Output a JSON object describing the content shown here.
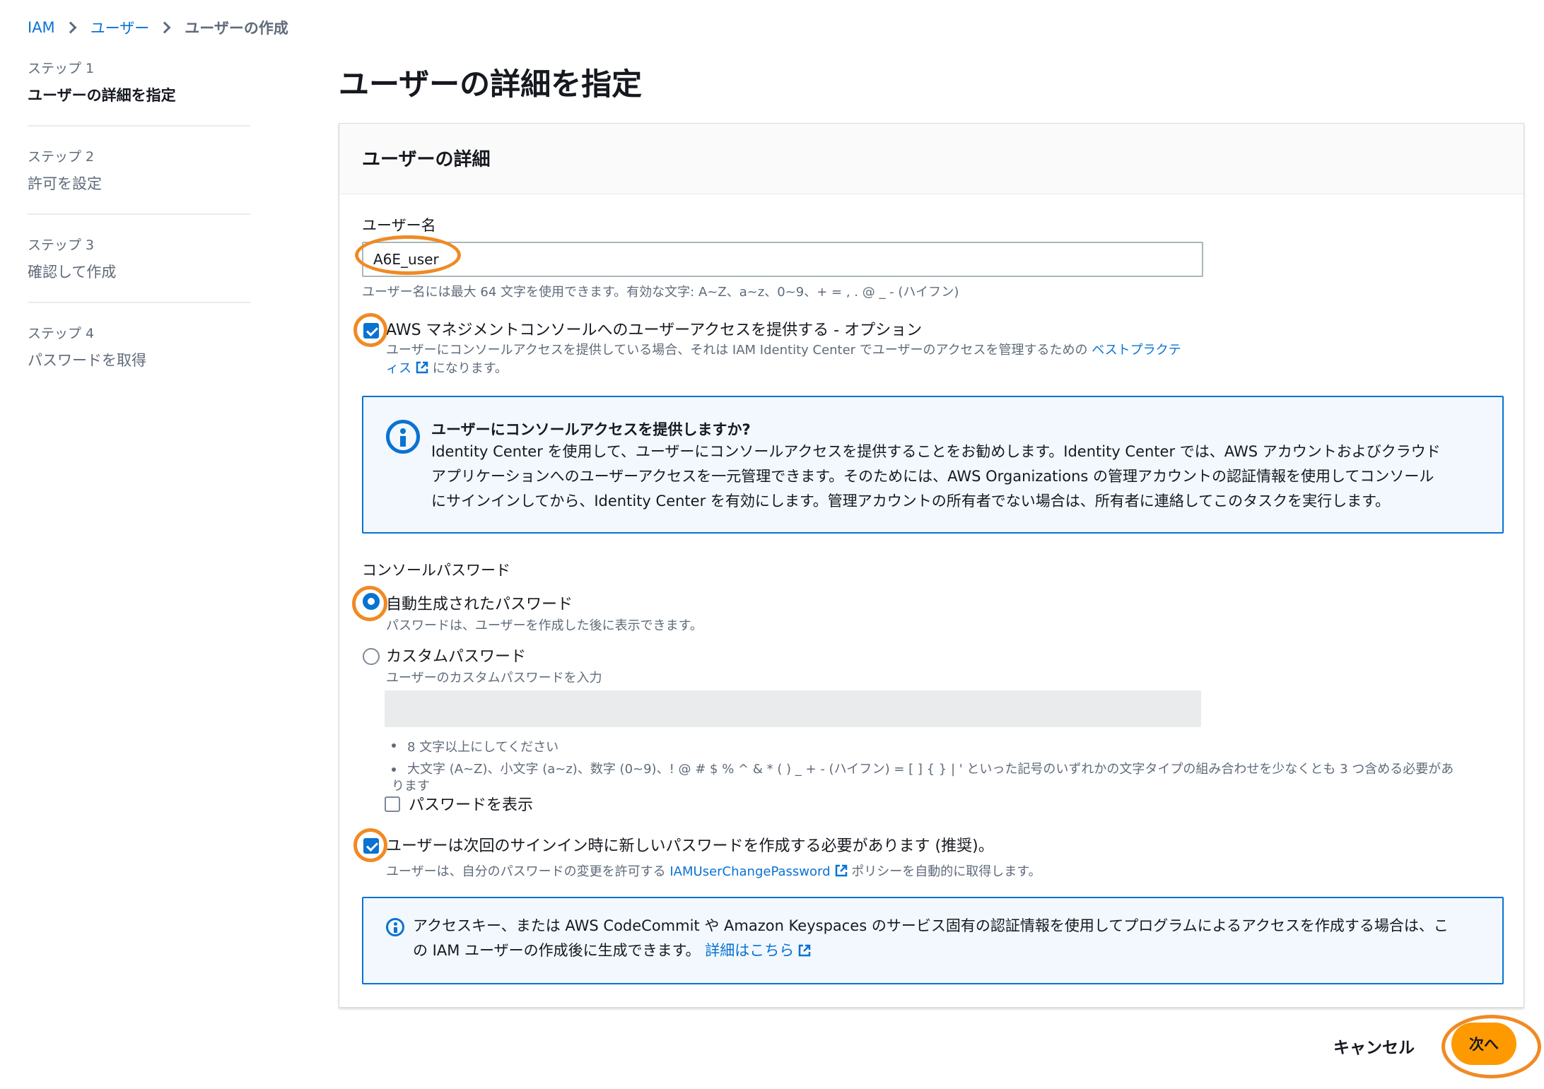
{
  "breadcrumb": {
    "items": [
      "IAM",
      "ユーザー",
      "ユーザーの作成"
    ]
  },
  "steps": [
    {
      "num": "ステップ 1",
      "title": "ユーザーの詳細を指定"
    },
    {
      "num": "ステップ 2",
      "title": "許可を設定"
    },
    {
      "num": "ステップ 3",
      "title": "確認して作成"
    },
    {
      "num": "ステップ 4",
      "title": "パスワードを取得"
    }
  ],
  "page_title": "ユーザーの詳細を指定",
  "panel": {
    "header": "ユーザーの詳細",
    "username_label": "ユーザー名",
    "username_value": "A6E_user",
    "username_hint": "ユーザー名には最大 64 文字を使用できます。有効な文字: A~Z、a~z、0~9、+ = , . @ _ - (ハイフン)",
    "console_access_label": "AWS マネジメントコンソールへのユーザーアクセスを提供する - オプション",
    "console_access_desc1": "ユーザーにコンソールアクセスを提供している場合、それは IAM Identity Center でユーザーのアクセスを管理するための",
    "console_access_link1": "ベストプラクテ",
    "console_access_link2": "ィス",
    "console_access_desc2": "になります。",
    "info1": {
      "title": "ユーザーにコンソールアクセスを提供しますか?",
      "line1": "Identity Center を使用して、ユーザーにコンソールアクセスを提供することをお勧めします。Identity Center では、AWS アカウントおよびクラウド",
      "line2": "アプリケーションへのユーザーアクセスを一元管理できます。そのためには、AWS Organizations の管理アカウントの認証情報を使用してコンソール",
      "line3": "にサインインしてから、Identity Center を有効にします。管理アカウントの所有者でない場合は、所有者に連絡してこのタスクを実行します。"
    },
    "console_password_label": "コンソールパスワード",
    "radio_auto_label": "自動生成されたパスワード",
    "radio_auto_desc": "パスワードは、ユーザーを作成した後に表示できます。",
    "radio_custom_label": "カスタムパスワード",
    "radio_custom_desc": "ユーザーのカスタムパスワードを入力",
    "bullet1": "8 文字以上にしてください",
    "bullet2a": "大文字 (A~Z)、小文字 (a~z)、数字 (0~9)、! @ # $ % ^ & * ( ) _ + - (ハイフン) = [ ] { } | ' といった記号のいずれかの文字タイプの組み合わせを少なくとも 3 つ含める必要があ",
    "bullet2b": "ります",
    "show_password_label": "パスワードを表示",
    "require_reset_label": "ユーザーは次回のサインイン時に新しいパスワードを作成する必要があります (推奨)。",
    "require_reset_desc1": "ユーザーは、自分のパスワードの変更を許可する",
    "require_reset_link": "IAMUserChangePassword",
    "require_reset_desc2": "ポリシーを自動的に取得します。",
    "info2": {
      "line1": "アクセスキー、または AWS CodeCommit や Amazon Keyspaces のサービス固有の認証情報を使用してプログラムによるアクセスを作成する場合は、こ",
      "line2": "の IAM ユーザーの作成後に生成できます。",
      "link": "詳細はこちら"
    }
  },
  "footer": {
    "cancel": "キャンセル",
    "next": "次へ"
  },
  "colors": {
    "accent": "#0972d3",
    "primary_button": "#ff9900",
    "highlight": "#f08a24"
  }
}
